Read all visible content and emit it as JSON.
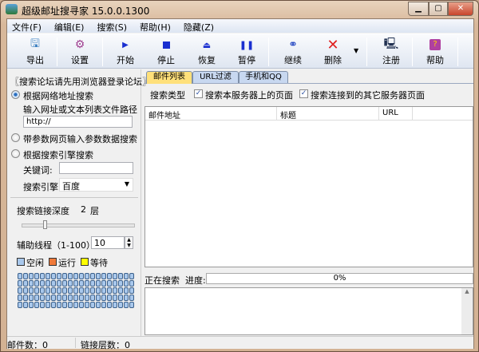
{
  "window": {
    "title": "超级邮址搜寻家 15.0.0.1300",
    "controls": [
      "minimize",
      "maximize",
      "close"
    ]
  },
  "menu": [
    "文件(F)",
    "编辑(E)",
    "搜索(S)",
    "帮助(H)",
    "隐藏(Z)"
  ],
  "toolbar": [
    {
      "label": "导出",
      "icon": "export-icon"
    },
    {
      "label": "设置",
      "icon": "settings-icon"
    },
    {
      "label": "开始",
      "icon": "play-icon"
    },
    {
      "label": "停止",
      "icon": "stop-icon"
    },
    {
      "label": "恢复",
      "icon": "eject-icon"
    },
    {
      "label": "暂停",
      "icon": "pause-icon"
    },
    {
      "label": "继续",
      "icon": "binoculars-icon"
    },
    {
      "label": "删除",
      "icon": "delete-x-icon"
    },
    {
      "label": "注册",
      "icon": "computer-icon"
    },
    {
      "label": "帮助",
      "icon": "help-book-icon"
    }
  ],
  "left": {
    "notice": "〖搜索论坛请先用浏览器登录论坛〗",
    "radio_url": "根据网络地址搜索",
    "url_hint": "输入网址或文本列表文件路径",
    "url_value": "http://",
    "radio_param": "带参数网页输入参数数据搜索",
    "radio_engine": "根据搜索引擎搜索",
    "keyword_label": "关键词:",
    "keyword_value": "",
    "engine_label": "搜索引擎",
    "engine_value": "百度",
    "depth_label": "搜索链接深度",
    "depth_value": "2",
    "depth_unit": "层",
    "depth_slider_value": 2,
    "threads_label": "辅助线程（1-100）",
    "threads_value": "10",
    "legend": [
      {
        "label": "空闲",
        "color": "#a9c8ec"
      },
      {
        "label": "运行",
        "color": "#f07a3a"
      },
      {
        "label": "等待",
        "color": "#ffff00"
      }
    ]
  },
  "right": {
    "tabs": [
      "邮件列表",
      "URL过滤",
      "手机和QQ"
    ],
    "search_type_label": "搜索类型",
    "check1": "搜索本服务器上的页面",
    "check2": "搜索连接到的其它服务器页面",
    "columns": [
      "邮件地址",
      "标题",
      "URL"
    ],
    "progress_label": "正在搜索  进度:",
    "progress_text": "0%",
    "progress_value": 0
  },
  "status": {
    "emails": "邮件数：0",
    "links": "链接层数：0"
  }
}
